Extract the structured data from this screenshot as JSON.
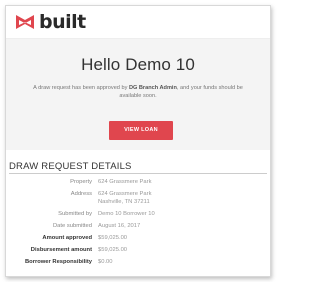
{
  "brand": {
    "name": "built",
    "logo_icon": "built-logo-icon",
    "accent_color": "#e0464e"
  },
  "hero": {
    "title": "Hello Demo 10",
    "message_prefix": "A draw request has been approved by ",
    "approver": "DG Branch Admin",
    "message_suffix": ", and your funds should be available soon.",
    "button_label": "VIEW LOAN"
  },
  "details": {
    "section_title": "DRAW REQUEST DETAILS",
    "rows": [
      {
        "label": "Property",
        "value": "624 Grassmere Park"
      },
      {
        "label": "Address",
        "value": "624 Grassmere Park\nNashville, TN 37211"
      },
      {
        "label": "Submitted by",
        "value": "Demo 10 Borrower 10"
      },
      {
        "label": "Date submitted",
        "value": "August 16, 2017"
      },
      {
        "label": "Amount approved",
        "value": "$59,025.00"
      },
      {
        "label": "Disbursement amount",
        "value": "$59,025.00"
      },
      {
        "label": "Borrower Responsibility",
        "value": "$0.00"
      }
    ]
  }
}
